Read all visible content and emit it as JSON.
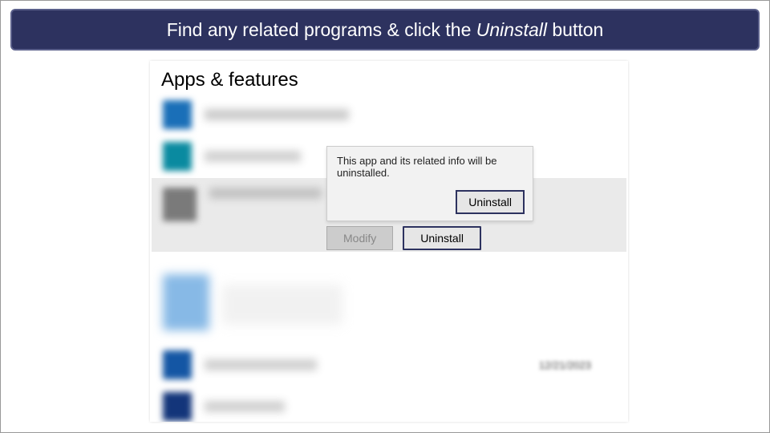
{
  "banner": {
    "prefix": "Find any related programs & click the ",
    "emphasis": "Uninstall",
    "suffix": " button"
  },
  "page_title": "Apps & features",
  "selected_app": {
    "modify_label": "Modify",
    "uninstall_label": "Uninstall"
  },
  "flyout": {
    "message": "This app and its related info will be uninstalled.",
    "confirm_label": "Uninstall"
  },
  "visible_date": "12/21/2023"
}
